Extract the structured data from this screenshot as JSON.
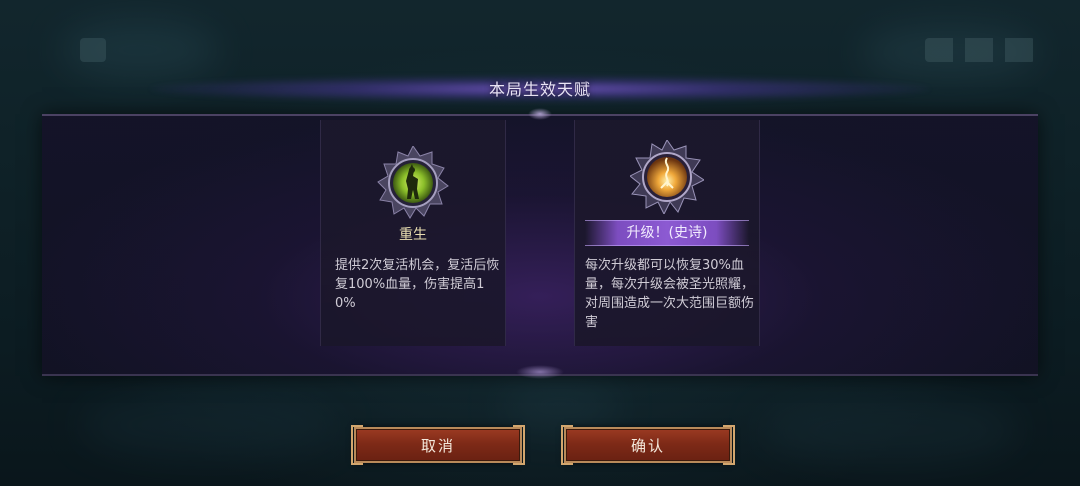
{
  "dialog": {
    "title": "本局生效天赋"
  },
  "talents": [
    {
      "name": "重生",
      "icon": "rebirth-icon",
      "description": "提供2次复活机会，复活后恢复100%血量，伤害提高10%",
      "accent": "#9ccc3a"
    },
    {
      "name": "升级！(史诗)",
      "icon": "level-up-icon",
      "description": "每次升级都可以恢复30%血量，每次升级会被圣光照耀，对周围造成一次大范围巨额伤害",
      "accent": "#e8a13a",
      "rarity_color": "#8c5ad2"
    }
  ],
  "buttons": {
    "cancel": "取消",
    "confirm": "确认"
  }
}
